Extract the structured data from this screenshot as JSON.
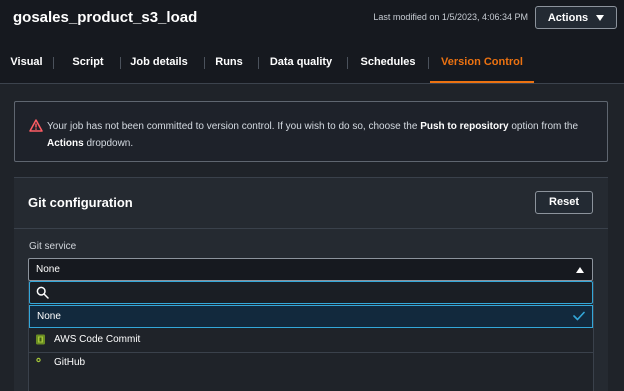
{
  "header": {
    "job_title": "gosales_product_s3_load",
    "last_modified": "Last modified on 1/5/2023, 4:06:34 PM",
    "actions_label": "Actions"
  },
  "tabs": [
    {
      "label": "Visual"
    },
    {
      "label": "Script"
    },
    {
      "label": "Job details"
    },
    {
      "label": "Runs"
    },
    {
      "label": "Data quality"
    },
    {
      "label": "Schedules"
    },
    {
      "label": "Version Control",
      "active": true
    }
  ],
  "alert": {
    "text_1": "Your job has not been committed to version control. If you wish to do so, choose the ",
    "bold_1": "Push to repository",
    "text_2": " option from the ",
    "bold_2": "Actions",
    "text_3": " dropdown."
  },
  "git_config": {
    "title": "Git configuration",
    "reset_label": "Reset",
    "service_label": "Git service",
    "selected_value": "None",
    "search_placeholder": "",
    "options": [
      {
        "label": "None",
        "selected": true,
        "icon": "none"
      },
      {
        "label": "AWS Code Commit",
        "selected": false,
        "icon": "codecommit-icon"
      },
      {
        "label": "GitHub",
        "selected": false,
        "icon": "github-icon"
      }
    ]
  },
  "colors": {
    "accent_orange": "#ec7211",
    "focus_blue": "#33a7d9",
    "warning_red": "#ff5d64",
    "background": "#16191f"
  }
}
